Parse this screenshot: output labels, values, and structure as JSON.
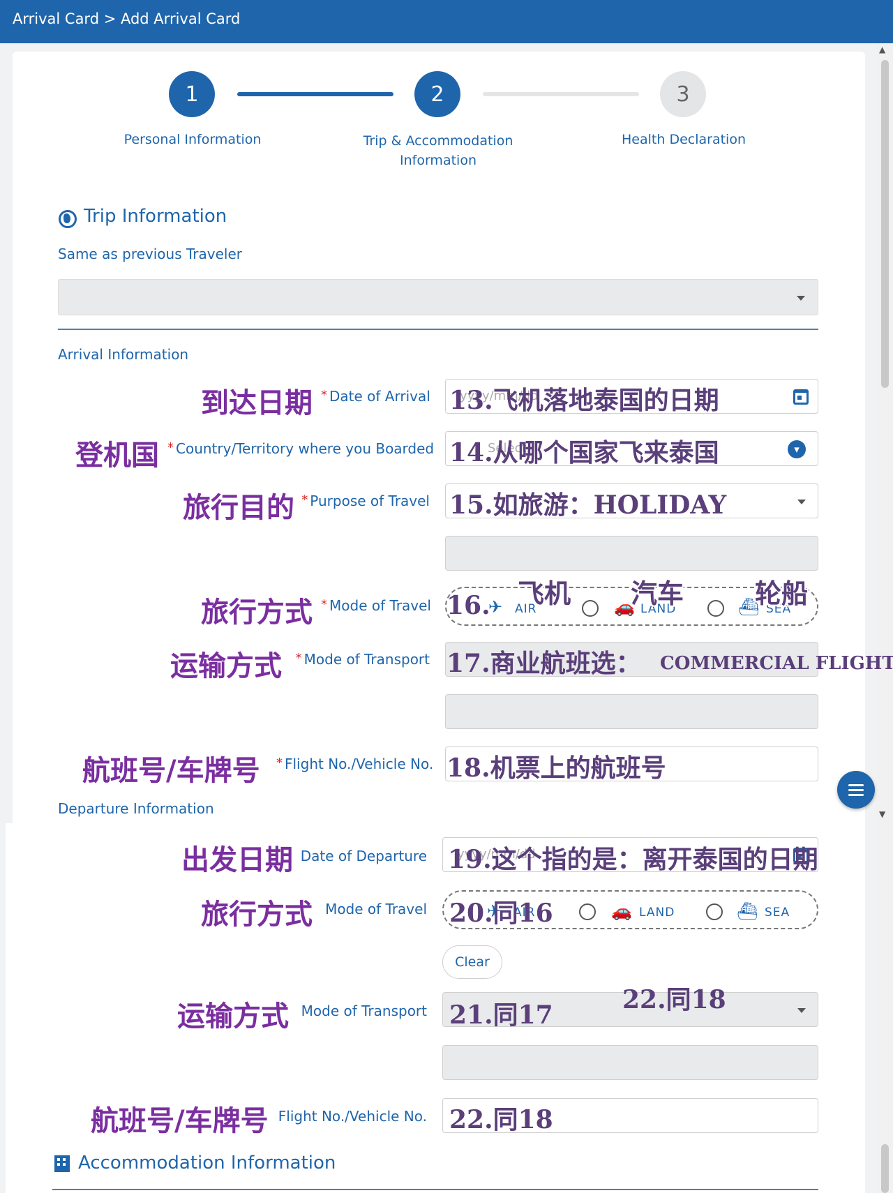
{
  "header": {
    "breadcrumb": "Arrival Card > Add Arrival Card"
  },
  "stepper": {
    "steps": [
      {
        "number": "1",
        "label": "Personal Information"
      },
      {
        "number": "2",
        "label": "Trip & Accommodation Information"
      },
      {
        "number": "3",
        "label": "Health Declaration"
      }
    ]
  },
  "trip": {
    "title": "Trip Information",
    "same_as_label": "Same as previous Traveler"
  },
  "arrival": {
    "title": "Arrival Information",
    "date": {
      "cn": "到达日期",
      "label": "Date of Arrival",
      "placeholder": "yyyy/mm/dd",
      "annotation": "13.飞机落地泰国的日期"
    },
    "country": {
      "cn": "登机国",
      "label": "Country/Territory where you Boarded",
      "placeholder": "Select...",
      "annotation": "14.从哪个国家飞来泰国"
    },
    "purpose": {
      "cn": "旅行目的",
      "label": "Purpose of Travel",
      "annotation": "15.如旅游：HOLIDAY"
    },
    "mode": {
      "cn": "旅行方式",
      "label": "Mode of Travel",
      "annotation": "16.",
      "options": [
        {
          "label": "AIR",
          "cn": "飞机"
        },
        {
          "label": "LAND",
          "cn": "汽车"
        },
        {
          "label": "SEA",
          "cn": "轮船"
        }
      ]
    },
    "transport": {
      "cn": "运输方式",
      "label": "Mode of Transport",
      "annotation": "17.商业航班选：",
      "annotation_value": "COMMERCIAL FLIGHT"
    },
    "flight": {
      "cn": "航班号/车牌号",
      "label": "Flight No./Vehicle No.",
      "annotation": "18.机票上的航班号"
    }
  },
  "departure": {
    "title": "Departure Information",
    "date": {
      "cn": "出发日期",
      "label": "Date of Departure",
      "placeholder": "yyyy/mm/dd",
      "annotation": "19.这个指的是：离开泰国的日期"
    },
    "mode": {
      "cn": "旅行方式",
      "label": "Mode of Travel",
      "annotation": "20.同16",
      "options": [
        {
          "label": "AIR"
        },
        {
          "label": "LAND"
        },
        {
          "label": "SEA"
        }
      ]
    },
    "clear_label": "Clear",
    "transport": {
      "cn": "运输方式",
      "label": "Mode of Transport",
      "annotation": "21.同17",
      "annotation_extra": "22.同18"
    },
    "flight": {
      "cn": "航班号/车牌号",
      "label": "Flight No./Vehicle No.",
      "annotation": "22.同18"
    }
  },
  "accommodation": {
    "title": "Accommodation Information"
  },
  "colors": {
    "primary": "#1f65ab",
    "required": "#d62828",
    "annotation": "#5a3f7a",
    "cn_label": "#7b2ea0"
  },
  "icons": {
    "trip": "globe-icon",
    "accommodation": "building-icon",
    "date": "calendar-icon",
    "menu": "menu-icon"
  }
}
